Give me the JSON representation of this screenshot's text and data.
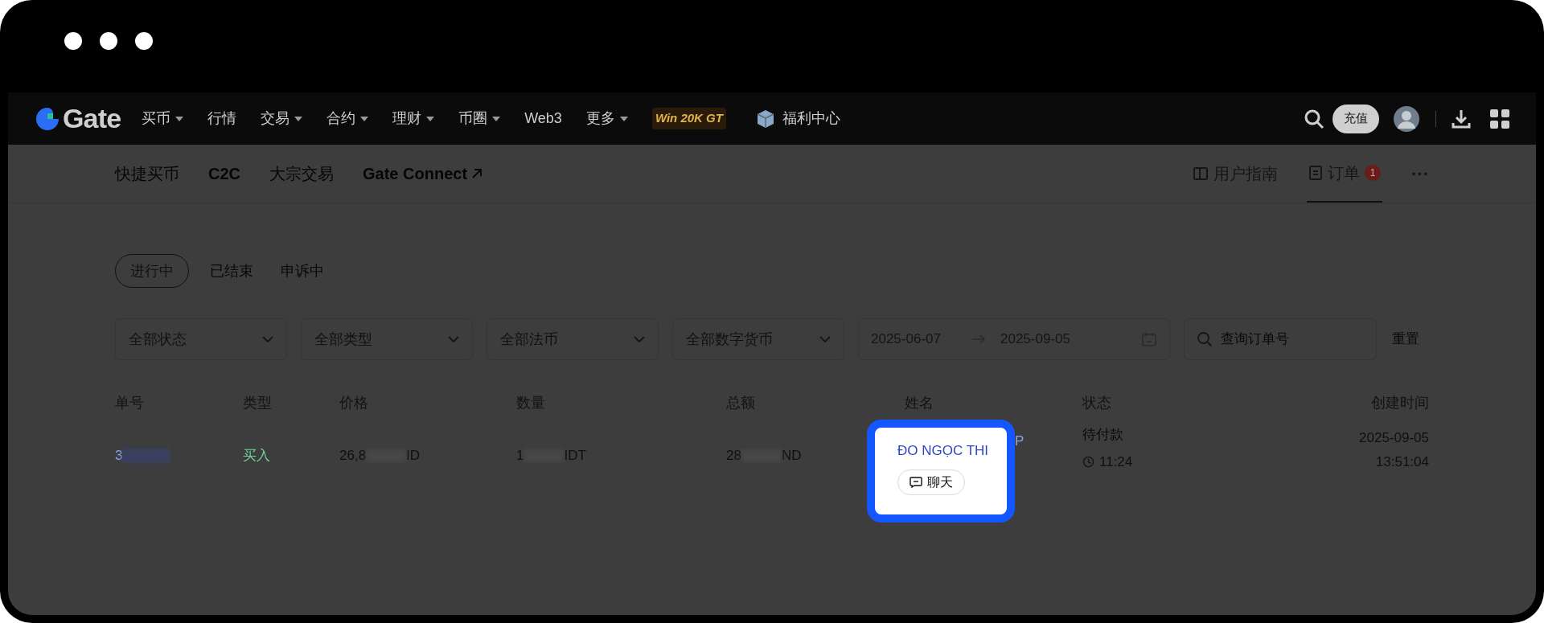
{
  "nav": {
    "logo": "Gate",
    "items": [
      {
        "label": "买币",
        "dropdown": true
      },
      {
        "label": "行情",
        "dropdown": false
      },
      {
        "label": "交易",
        "dropdown": true
      },
      {
        "label": "合约",
        "dropdown": true
      },
      {
        "label": "理财",
        "dropdown": true
      },
      {
        "label": "币圈",
        "dropdown": true
      },
      {
        "label": "Web3",
        "dropdown": false
      },
      {
        "label": "更多",
        "dropdown": true
      }
    ],
    "promo": "Win 20K GT",
    "welfare": "福利中心",
    "deposit": "充值"
  },
  "subnav": {
    "items": [
      {
        "label": "快捷买币",
        "kind": "plain"
      },
      {
        "label": "C2C",
        "kind": "plain"
      },
      {
        "label": "大宗交易",
        "kind": "plain"
      },
      {
        "label": "Gate Connect",
        "kind": "external"
      }
    ],
    "guide": "用户指南",
    "orders": {
      "label": "订单",
      "badge": "1",
      "selected": true
    },
    "more": "···"
  },
  "status_tabs": [
    {
      "label": "进行中",
      "selected": true
    },
    {
      "label": "已结束",
      "selected": false
    },
    {
      "label": "申诉中",
      "selected": false
    }
  ],
  "filters": {
    "selects": [
      "全部状态",
      "全部类型",
      "全部法币",
      "全部数字货币"
    ],
    "date_from": "2025-06-07",
    "date_to": "2025-09-05",
    "search_placeholder": "查询订单号",
    "reset": "重置"
  },
  "table": {
    "columns": [
      "单号",
      "类型",
      "价格",
      "数量",
      "总额",
      "姓名",
      "状态",
      "创建时间"
    ],
    "rows": [
      {
        "order_no": "3",
        "type": "买入",
        "price": [
          "26,8",
          "ID"
        ],
        "amount": [
          "1",
          "IDT"
        ],
        "total": [
          "28",
          "ND"
        ],
        "name": "ĐO NGỌC THI",
        "name_tail": "P",
        "chat": "聊天",
        "status": "待付款",
        "countdown": "11:24",
        "date": "2025-09-05",
        "time": "13:51:04"
      }
    ]
  }
}
